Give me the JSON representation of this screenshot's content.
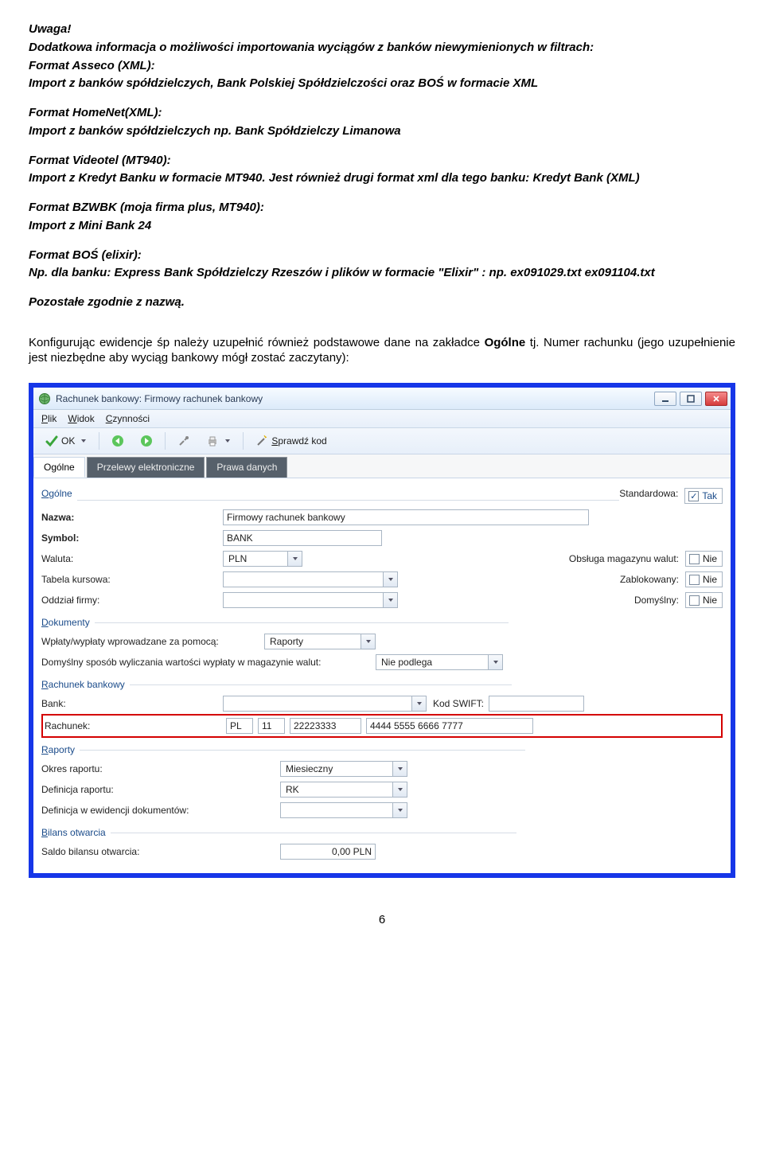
{
  "doc": {
    "uwaga": "Uwaga!",
    "intro": "Dodatkowa informacja o możliwości importowania wyciągów z banków niewymienionych w filtrach:",
    "asseco_hdr": "Format Asseco (XML):",
    "asseco_body": "Import z banków spółdzielczych, Bank Polskiej Spółdzielczości oraz BOŚ w formacie XML",
    "homenet_hdr": "Format HomeNet(XML):",
    "homenet_body": "Import z banków spółdzielczych np. Bank Spółdzielczy Limanowa",
    "videotel_hdr": "Format Videotel (MT940):",
    "videotel_body": "Import z Kredyt Banku w formacie MT940. Jest również drugi format xml dla tego banku: Kredyt Bank (XML)",
    "bzwbk_hdr": "Format BZWBK (moja firma plus, MT940):",
    "bzwbk_body": "Import z Mini Bank 24",
    "bos_hdr": "Format BOŚ (elixir):",
    "bos_body_pre": " Np. dla banku:  Express Bank Spółdzielczy Rzeszów i plików w formacie \"Elixir\" : np. ex091029.txt ex091104.txt",
    "pozostale": "Pozostałe zgodnie z nazwą.",
    "konfig_pre": "Konfigurując ewidencje śp należy uzupełnić również podstawowe dane na zakładce ",
    "konfig_tab": "Ogólne",
    "konfig_post": " tj. Numer rachunku (jego uzupełnienie jest niezbędne aby wyciąg bankowy mógł zostać zaczytany):",
    "page": "6"
  },
  "win": {
    "title": "Rachunek bankowy: Firmowy rachunek bankowy",
    "menu": {
      "plik": "Plik",
      "widok": "Widok",
      "czynnosci": "Czynności"
    },
    "toolbar": {
      "ok": "OK",
      "sprawdz": "Sprawdź kod"
    },
    "tabs": {
      "ogolne": "Ogólne",
      "prze": "Przelewy elektroniczne",
      "prawa": "Prawa danych"
    },
    "section_ogolne": "Ogólne",
    "nazwa_lbl": "Nazwa:",
    "nazwa_val": "Firmowy rachunek bankowy",
    "symbol_lbl": "Symbol:",
    "symbol_val": "BANK",
    "waluta_lbl": "Waluta:",
    "waluta_val": "PLN",
    "tabela_lbl": "Tabela kursowa:",
    "oddzial_lbl": "Oddział firmy:",
    "standardowa_lbl": "Standardowa:",
    "tak": "Tak",
    "obsluga_lbl": "Obsługa magazynu walut:",
    "zablokowany_lbl": "Zablokowany:",
    "domyslny_lbl": "Domyślny:",
    "nie": "Nie",
    "section_dokumenty": "Dokumenty",
    "wplaty_lbl": "Wpłaty/wypłaty wprowadzane za pomocą:",
    "wplaty_val": "Raporty",
    "domysl_wyp_lbl": "Domyślny sposób wyliczania wartości wypłaty w magazynie walut:",
    "domysl_wyp_val": "Nie podlega",
    "section_rachunek": "Rachunek bankowy",
    "bank_lbl": "Bank:",
    "swift_lbl": "Kod SWIFT:",
    "rach_lbl": "Rachunek:",
    "rach_pl": "PL",
    "rach_cc": "11",
    "rach_b": "22223333",
    "rach_rest": "4444 5555 6666 7777",
    "section_raporty": "Raporty",
    "okres_lbl": "Okres raportu:",
    "okres_val": "Miesieczny",
    "def_rap_lbl": "Definicja raportu:",
    "def_rap_val": "RK",
    "def_ewi_lbl": "Definicja w ewidencji dokumentów:",
    "section_bilans": "Bilans otwarcia",
    "saldo_lbl": "Saldo bilansu otwarcia:",
    "saldo_val": "0,00 PLN"
  }
}
